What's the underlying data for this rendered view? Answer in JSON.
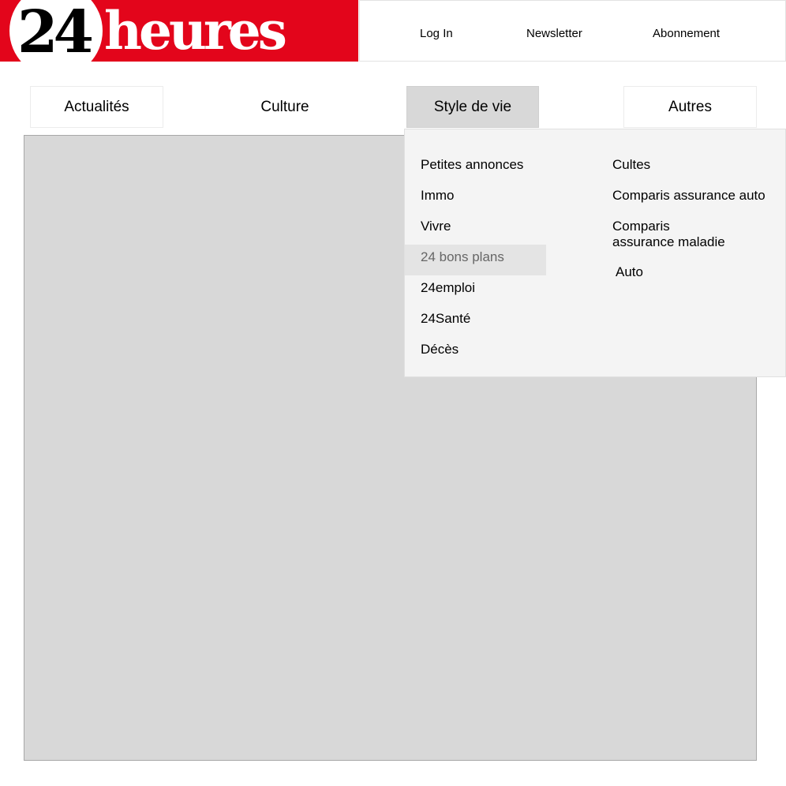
{
  "header": {
    "logo_number": "24",
    "logo_word": "heures",
    "links": [
      "Log In",
      "Newsletter",
      "Abonnement"
    ]
  },
  "nav": {
    "items": [
      "Actualités",
      "Culture",
      "Style de vie",
      "Autres"
    ],
    "active": "Style de vie"
  },
  "dropdown": {
    "left_column": [
      "Petites annonces",
      "Immo",
      "Vivre",
      "24 bons plans",
      "24emploi",
      "24Santé",
      "Décès"
    ],
    "right_column": [
      "Cultes",
      "Comparis assurance auto",
      "Comparis\nassurance maladie",
      "Auto"
    ],
    "highlighted": "24 bons plans"
  },
  "colors": {
    "brand_red": "#e3051b",
    "active_tab": "#d8d8d8",
    "dropdown_bg": "#f4f4f4",
    "content_placeholder": "#d8d8d8"
  }
}
